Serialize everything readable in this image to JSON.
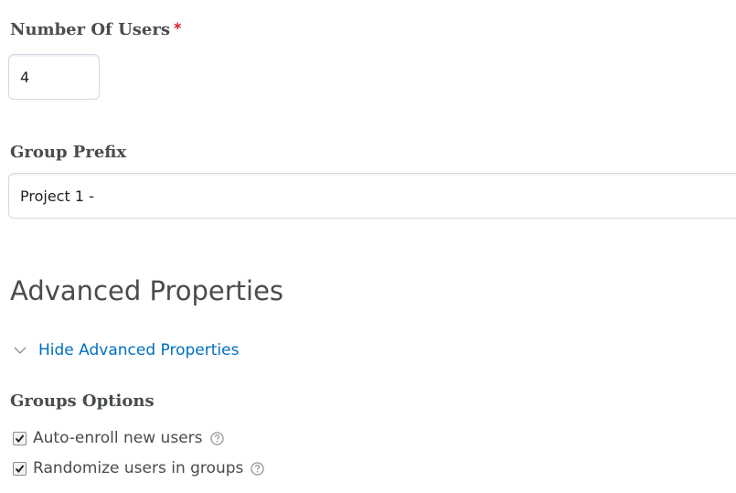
{
  "number_of_users": {
    "label": "Number Of Users",
    "required_mark": "*",
    "value": "4"
  },
  "group_prefix": {
    "label": "Group Prefix",
    "value": "Project 1 -"
  },
  "advanced": {
    "heading": "Advanced Properties",
    "toggle_label": "Hide Advanced Properties",
    "toggle_icon": "chevron-down-icon"
  },
  "groups_options": {
    "label": "Groups Options",
    "options": [
      {
        "label": "Auto-enroll new users",
        "checked": true,
        "help_icon": "help-icon"
      },
      {
        "label": "Randomize users in groups",
        "checked": true,
        "help_icon": "help-icon"
      }
    ]
  },
  "colors": {
    "link": "#006fbf",
    "required": "#cd2026",
    "text": "#494c4e",
    "input_border": "#d3d9e3"
  }
}
